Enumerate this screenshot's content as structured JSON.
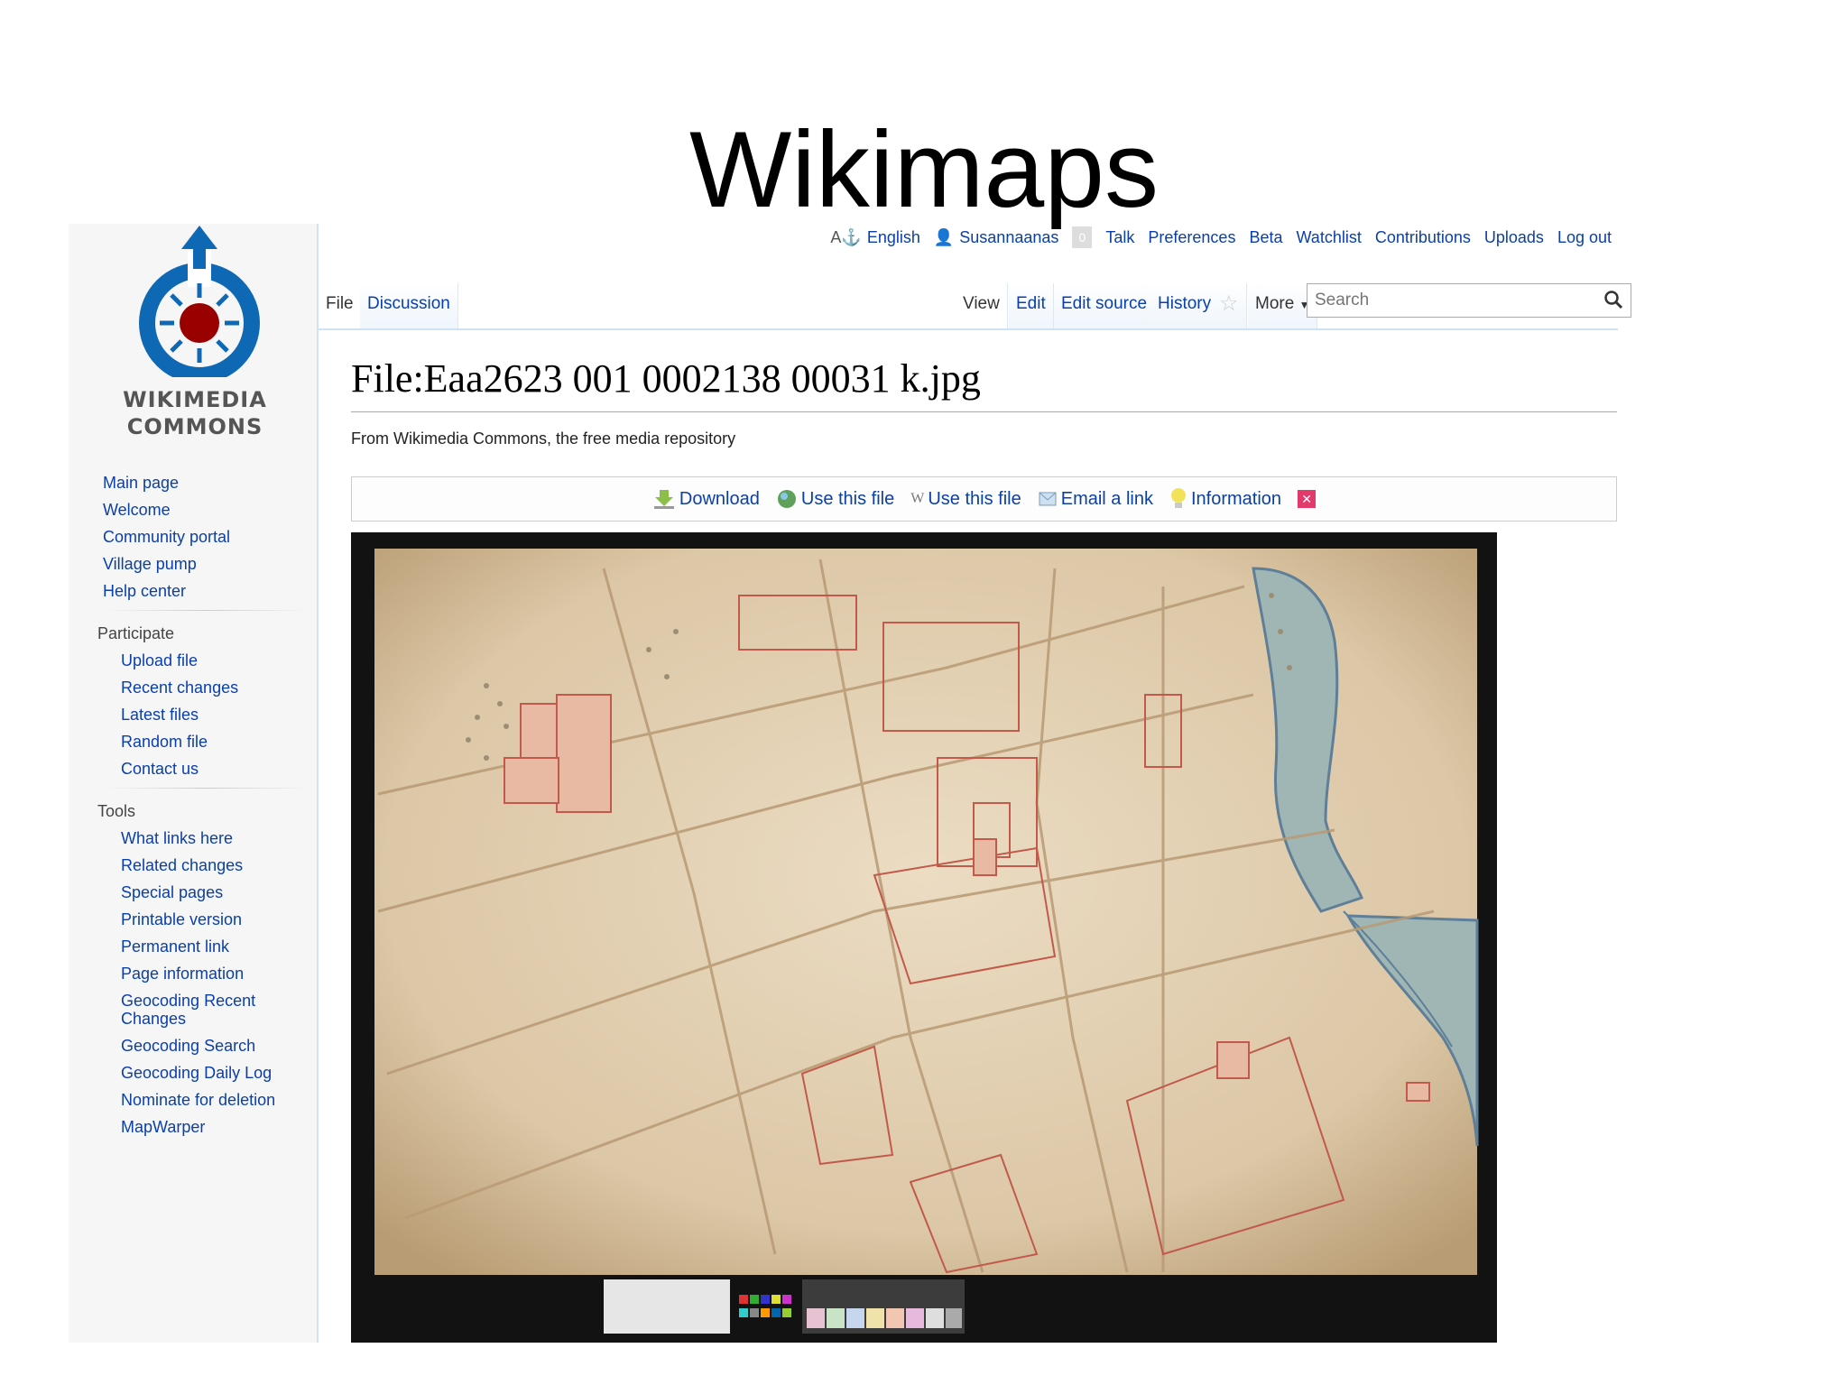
{
  "slide": {
    "title": "Wikimaps"
  },
  "personal_tools": {
    "language": "English",
    "username": "Susannaanas",
    "notification_count": "0",
    "talk": "Talk",
    "preferences": "Preferences",
    "beta": "Beta",
    "watchlist": "Watchlist",
    "contributions": "Contributions",
    "uploads": "Uploads",
    "logout": "Log out"
  },
  "logo": {
    "line1": "WIKIMEDIA",
    "line2": "COMMONS"
  },
  "sidebar": {
    "main": [
      "Main page",
      "Welcome",
      "Community portal",
      "Village pump",
      "Help center"
    ],
    "participate_heading": "Participate",
    "participate": [
      "Upload file",
      "Recent changes",
      "Latest files",
      "Random file",
      "Contact us"
    ],
    "tools_heading": "Tools",
    "tools": [
      "What links here",
      "Related changes",
      "Special pages",
      "Printable version",
      "Permanent link",
      "Page information",
      "Geocoding Recent Changes",
      "Geocoding Search",
      "Geocoding Daily Log",
      "Nominate for deletion",
      "MapWarper"
    ]
  },
  "tabs": {
    "file": "File",
    "discussion": "Discussion",
    "view": "View",
    "edit": "Edit",
    "edit_source": "Edit source",
    "history": "History",
    "more": "More"
  },
  "search": {
    "placeholder": "Search"
  },
  "page": {
    "title": "File:Eaa2623 001 0002138 00031 k.jpg",
    "tagline": "From Wikimedia Commons, the free media repository"
  },
  "actions": {
    "download": "Download",
    "use_file_1": "Use this file",
    "use_file_2": "Use this file",
    "email": "Email a link",
    "information": "Information"
  },
  "colors": {
    "link": "#0b3fa8",
    "logo_blue": "#0e68b4",
    "logo_red": "#990000",
    "paper": "#e2d2b8"
  }
}
